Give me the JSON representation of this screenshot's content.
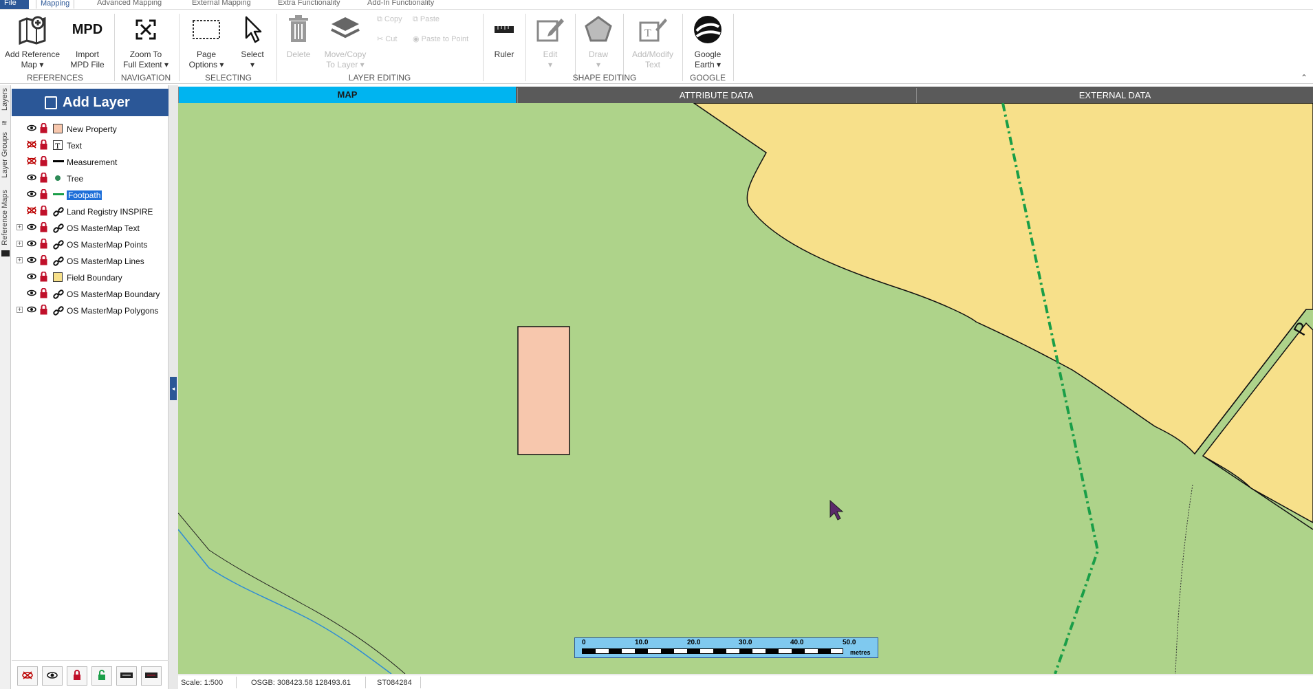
{
  "menu": {
    "tabs": [
      "File",
      "Mapping",
      "Advanced Mapping",
      "External Mapping",
      "Extra Functionality",
      "Add-In Functionality"
    ]
  },
  "ribbon": {
    "add_ref_map": [
      "Add Reference",
      "Map"
    ],
    "import_mpd": [
      "Import",
      "MPD File"
    ],
    "mpd_icon_text": "MPD",
    "zoom_full": [
      "Zoom To",
      "Full Extent"
    ],
    "page_options": [
      "Page",
      "Options"
    ],
    "select": "Select",
    "delete": "Delete",
    "move_copy": [
      "Move/Copy",
      "To Layer"
    ],
    "copy": "Copy",
    "paste": "Paste",
    "cut": "Cut",
    "paste_to_point": "Paste to Point",
    "ruler": "Ruler",
    "edit": "Edit",
    "draw": "Draw",
    "add_modify_text": [
      "Add/Modify",
      "Text"
    ],
    "google_earth": [
      "Google",
      "Earth"
    ],
    "groups": {
      "references": "REFERENCES",
      "navigation": "NAVIGATION",
      "selecting": "SELECTING",
      "layer_editing": "LAYER EDITING",
      "shape_editing": "SHAPE EDITING",
      "google": "GOOGLE"
    }
  },
  "side_tabs": [
    "Layers",
    "Layer Groups",
    "Reference Maps"
  ],
  "layer_panel": {
    "title": "Add Layer",
    "layers": [
      {
        "name": "New Property",
        "visible": true,
        "symbol": "polygon-fill",
        "color": "#f7c7ad",
        "expandable": false,
        "selected": false
      },
      {
        "name": "Text",
        "visible": false,
        "symbol": "text",
        "color": "#000000",
        "expandable": false,
        "selected": false
      },
      {
        "name": "Measurement",
        "visible": false,
        "symbol": "line",
        "color": "#000000",
        "expandable": false,
        "selected": false
      },
      {
        "name": "Tree",
        "visible": true,
        "symbol": "point",
        "color": "#2e8b57",
        "expandable": false,
        "selected": false
      },
      {
        "name": "Footpath",
        "visible": true,
        "symbol": "line",
        "color": "#1a9e48",
        "expandable": false,
        "selected": true
      },
      {
        "name": "Land Registry INSPIRE",
        "visible": false,
        "symbol": "link",
        "color": "#000000",
        "expandable": false,
        "selected": false
      },
      {
        "name": "OS MasterMap Text",
        "visible": true,
        "symbol": "link",
        "color": "#000000",
        "expandable": true,
        "selected": false
      },
      {
        "name": "OS MasterMap Points",
        "visible": true,
        "symbol": "link",
        "color": "#000000",
        "expandable": true,
        "selected": false
      },
      {
        "name": "OS MasterMap Lines",
        "visible": true,
        "symbol": "link",
        "color": "#000000",
        "expandable": true,
        "selected": false
      },
      {
        "name": "Field Boundary",
        "visible": true,
        "symbol": "polygon-fill",
        "color": "#f7e08a",
        "expandable": false,
        "selected": false
      },
      {
        "name": "OS MasterMap Boundary",
        "visible": true,
        "symbol": "link",
        "color": "#000000",
        "expandable": false,
        "selected": false
      },
      {
        "name": "OS MasterMap Polygons",
        "visible": true,
        "symbol": "link",
        "color": "#000000",
        "expandable": true,
        "selected": false
      }
    ]
  },
  "map_tabs": [
    "MAP",
    "ATTRIBUTE DATA",
    "EXTERNAL DATA"
  ],
  "map": {
    "background_color": "#aed38a",
    "field_color": "#f7e08a",
    "property_color": "#f7c7ad",
    "footpath_color": "#1a9e48",
    "edge_label": "P"
  },
  "scale_bar": {
    "ticks": [
      "0",
      "10.0",
      "20.0",
      "30.0",
      "40.0",
      "50.0"
    ],
    "unit": "metres"
  },
  "status": {
    "scale": "Scale: 1:500",
    "coords": "OSGB: 308423.58  128493.61",
    "grid_ref": "ST084284"
  }
}
